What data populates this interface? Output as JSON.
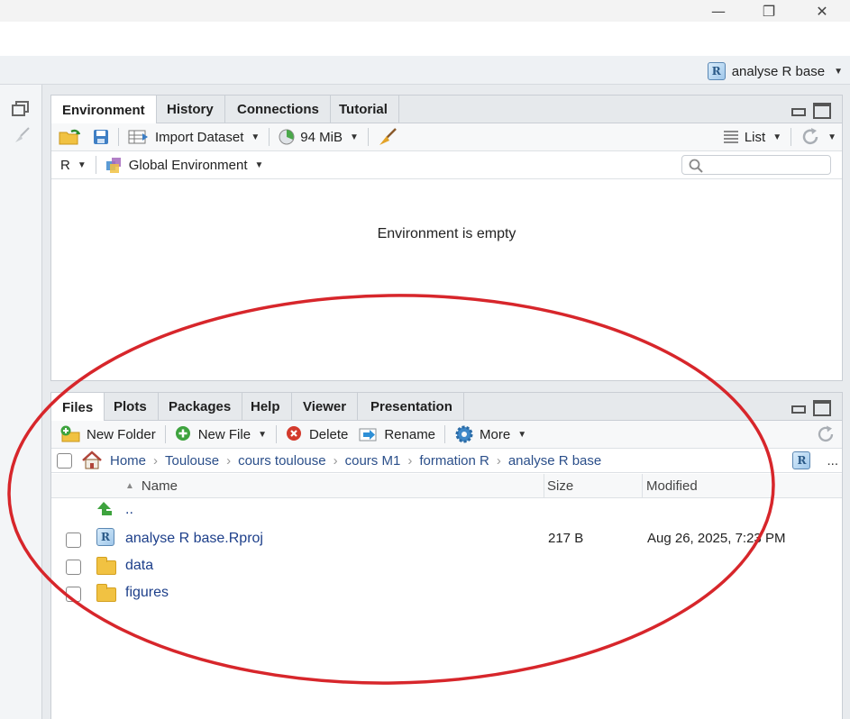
{
  "window": {
    "minimize_glyph": "—",
    "restore_glyph": "❐",
    "close_glyph": "✕"
  },
  "project": {
    "name": "analyse R base",
    "icon": "r-project-icon"
  },
  "top_pane": {
    "tabs": [
      "Environment",
      "History",
      "Connections",
      "Tutorial"
    ],
    "active_tab": "Environment",
    "toolbar": {
      "import_label": "Import Dataset",
      "memory_label": "94 MiB",
      "view_label": "List"
    },
    "selectors": {
      "language": "R",
      "environment": "Global Environment"
    },
    "search_placeholder": "",
    "empty_message": "Environment is empty"
  },
  "bottom_pane": {
    "tabs": [
      "Files",
      "Plots",
      "Packages",
      "Help",
      "Viewer",
      "Presentation"
    ],
    "active_tab": "Files",
    "toolbar": {
      "new_folder": "New Folder",
      "new_file": "New File",
      "delete": "Delete",
      "rename": "Rename",
      "more": "More"
    },
    "breadcrumb": [
      "Home",
      "Toulouse",
      "cours toulouse",
      "cours M1",
      "formation R",
      "analyse R base"
    ],
    "more_glyph": "...",
    "columns": {
      "name": "Name",
      "size": "Size",
      "modified": "Modified"
    },
    "parent_label": "..",
    "files": [
      {
        "name": "analyse R base.Rproj",
        "size": "217 B",
        "modified": "Aug 26, 2025, 7:23 PM",
        "icon": "r-project-icon"
      },
      {
        "name": "data",
        "size": "",
        "modified": "",
        "icon": "folder-icon"
      },
      {
        "name": "figures",
        "size": "",
        "modified": "",
        "icon": "folder-icon"
      }
    ]
  },
  "annotation": {
    "color": "#d7262b"
  }
}
